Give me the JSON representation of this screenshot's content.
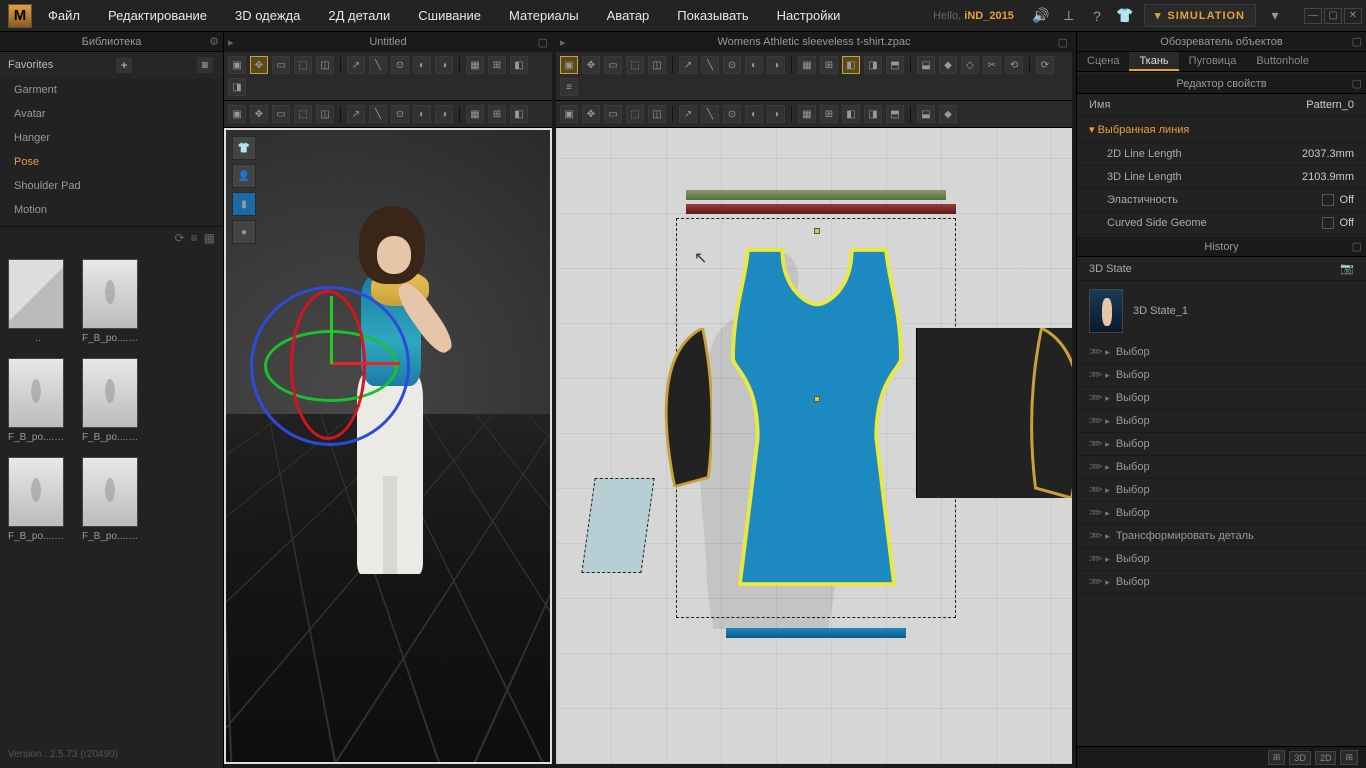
{
  "menubar": {
    "items": [
      "Файл",
      "Редактирование",
      "3D одежда",
      "2Д детали",
      "Сшивание",
      "Материалы",
      "Аватар",
      "Показывать",
      "Настройки"
    ],
    "hello_prefix": "Hello, ",
    "username": "iND_2015",
    "sim_label": "SIMULATION"
  },
  "library": {
    "title": "Библиотека",
    "favorites_label": "Favorites",
    "items": [
      "Garment",
      "Avatar",
      "Hanger",
      "Pose",
      "Shoulder Pad",
      "Motion"
    ],
    "active_index": 3,
    "thumbs": [
      {
        "label": "..",
        "folder": true
      },
      {
        "label": "F_B_po....pos"
      },
      {
        "label": "F_B_po....pos"
      },
      {
        "label": "F_B_po....pos"
      },
      {
        "label": "F_B_po....pos"
      },
      {
        "label": "F_B_po....pos"
      }
    ],
    "version": "Version : 2.5.73   (r20490)"
  },
  "view3d": {
    "title": "Untitled"
  },
  "view2d": {
    "title": "Womens Athletic sleeveless t-shirt.zpac"
  },
  "object_browser": {
    "title": "Обозреватель объектов",
    "tabs": [
      "Сцена",
      "Ткань",
      "Пуговица",
      "Buttonhole"
    ],
    "active_tab": 1
  },
  "property_editor": {
    "title": "Редактор свойств",
    "name_key": "Имя",
    "name_val": "Pattern_0",
    "section": "Выбранная линия",
    "rows": [
      {
        "k": "2D Line Length",
        "v": "2037.3mm"
      },
      {
        "k": "3D Line Length",
        "v": "2103.9mm"
      },
      {
        "k": "Эластичность",
        "v": "Off",
        "chk": true
      },
      {
        "k": "Curved Side Geome",
        "v": "Off",
        "chk": true
      }
    ]
  },
  "history": {
    "title": "History",
    "state_label": "3D State",
    "state_item": "3D State_1",
    "items": [
      "Выбор",
      "Выбор",
      "Выбор",
      "Выбор",
      "Выбор",
      "Выбор",
      "Выбор",
      "Выбор",
      "Трансформировать деталь",
      "Выбор",
      "Выбор"
    ]
  },
  "footer": {
    "buttons": [
      "",
      "3D",
      "2D",
      ""
    ]
  }
}
